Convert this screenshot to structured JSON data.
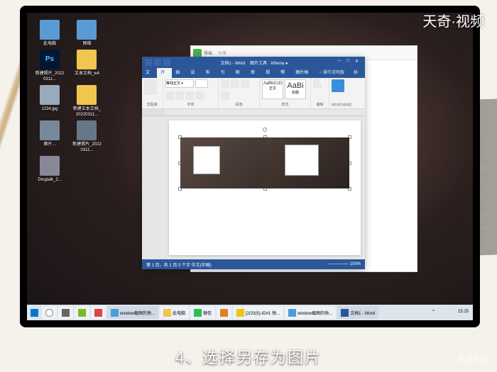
{
  "watermarks": {
    "top_right": "天奇·视频",
    "bottom_right": "ⓒ 天奇生活"
  },
  "caption": "4、选择另存为图片",
  "desktop": {
    "icons": [
      {
        "label": "此电脑",
        "type": "sys"
      },
      {
        "label": "网络",
        "type": "sys"
      },
      {
        "label": "新建照片_20220311...",
        "type": "ps"
      },
      {
        "label": "文本文档_w4",
        "type": "folder"
      },
      {
        "label": "1234.jpg",
        "type": "img"
      },
      {
        "label": "新建文本文档_20220311...",
        "type": "folder"
      },
      {
        "label": "图片...",
        "type": "img"
      },
      {
        "label": "新建照片_20220311...",
        "type": "img"
      },
      {
        "label": "Dingtalk_2...",
        "type": "img"
      }
    ]
  },
  "background_app": {
    "tab1": "导出",
    "tab2": "分享"
  },
  "word": {
    "title_center": "文档1 - Word",
    "title_right_section": "图片工具",
    "user": "Athena",
    "tabs": [
      "文件",
      "开始",
      "插入",
      "设计",
      "布局",
      "引用",
      "邮件",
      "审阅",
      "视图",
      "帮助",
      "图片格式"
    ],
    "active_tab": "开始",
    "tell_me": "操作说明搜索",
    "share": "共享",
    "ribbon": {
      "clipboard": "剪贴板",
      "font": "字体",
      "paragraph": "段落",
      "style_label_1": "AaBbCcD",
      "style_label_2": "AaBi",
      "styles": "样式",
      "editing": "编辑",
      "save": "保存到百度网盘"
    },
    "status": {
      "left": "第 1 页，共 1 页    0 个字    中文(中国)",
      "zoom": "100%"
    }
  },
  "taskbar": {
    "items": [
      {
        "label": "",
        "icon": "search"
      },
      {
        "label": "",
        "icon": "taskview"
      },
      {
        "label": "",
        "icon": "app"
      },
      {
        "label": "",
        "icon": "app"
      },
      {
        "label": "window截图的快...",
        "icon": "browser"
      },
      {
        "label": "此电脑",
        "icon": "explorer"
      },
      {
        "label": "微信",
        "icon": "wechat"
      },
      {
        "label": "",
        "icon": "app"
      },
      {
        "label": "[2/23(5)-ID#1 快...",
        "icon": "app"
      },
      {
        "label": "window截图的快...",
        "icon": "app"
      },
      {
        "label": "文档1 - Word",
        "icon": "word"
      }
    ],
    "time": "15:15"
  }
}
